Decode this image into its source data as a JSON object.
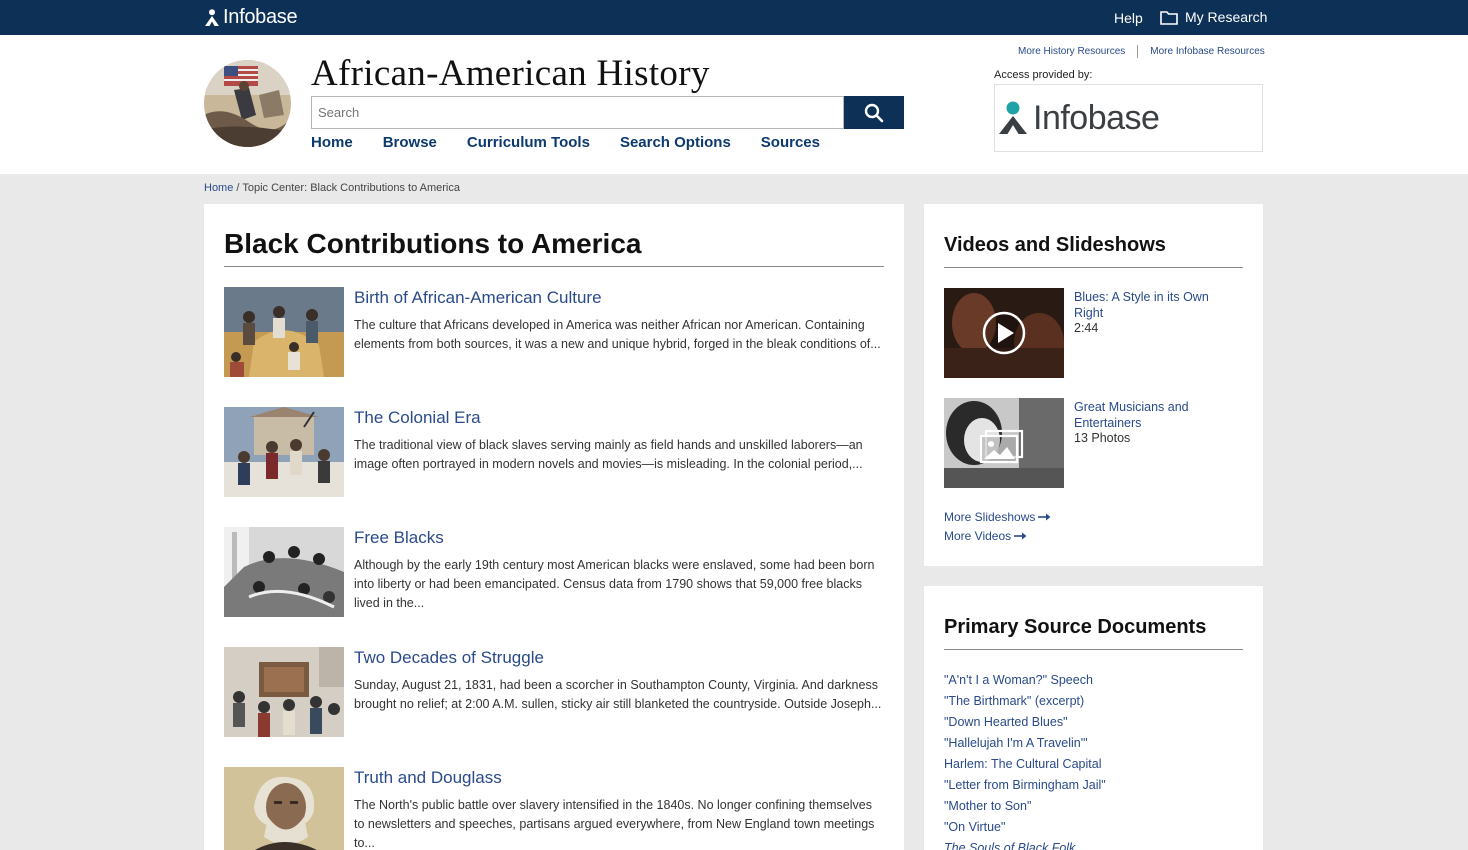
{
  "topbar": {
    "logo_text": "Infobase",
    "help": "Help",
    "my_research": "My Research"
  },
  "header": {
    "site_title": "African-American History",
    "search_placeholder": "Search",
    "nav": [
      "Home",
      "Browse",
      "Curriculum Tools",
      "Search Options",
      "Sources"
    ],
    "more_history": "More History Resources",
    "more_infobase": "More Infobase Resources",
    "access_label": "Access provided by:",
    "access_logo_text": "Infobase"
  },
  "breadcrumb": {
    "home": "Home",
    "separator": " / ",
    "current": "Topic Center: Black Contributions to America"
  },
  "main": {
    "title": "Black Contributions to America",
    "articles": [
      {
        "title": "Birth of African-American Culture",
        "summary": "The culture that Africans developed in America was neither African nor American. Containing elements from both sources, it was a new and unique hybrid, forged in the bleak conditions of..."
      },
      {
        "title": "The Colonial Era",
        "summary": "The traditional view of black slaves serving mainly as field hands and unskilled laborers—an image often portrayed in modern novels and movies—is misleading. In the colonial period,..."
      },
      {
        "title": "Free Blacks",
        "summary": "Although by the early 19th century most American blacks were enslaved, some had been born into liberty or had been emancipated. Census data from 1790 shows that 59,000 free blacks lived in the..."
      },
      {
        "title": "Two Decades of Struggle",
        "summary": "Sunday, August 21, 1831, had been a scorcher in Southampton County, Virginia. And darkness brought no relief; at 2:00 A.M. sullen, sticky air still blanketed the countryside. Outside Joseph..."
      },
      {
        "title": "Truth and Douglass",
        "summary": "The North's public battle over slavery intensified in the 1840s. No longer confining themselves to newsletters and speeches, partisans argued everywhere, from New England town meetings to..."
      }
    ]
  },
  "videos": {
    "title": "Videos and Slideshows",
    "items": [
      {
        "title": "Blues: A Style in its Own Right",
        "meta": "2:44",
        "icon": "play-icon"
      },
      {
        "title": "Great Musicians and Entertainers",
        "meta": "13 Photos",
        "icon": "slideshow-icon"
      }
    ],
    "more_slideshows": "More Slideshows",
    "more_videos": "More Videos"
  },
  "documents": {
    "title": "Primary Source Documents",
    "items": [
      "\"A'n't I a Woman?\" Speech",
      "\"The Birthmark\" (excerpt)",
      "\"Down Hearted Blues\"",
      "\"Hallelujah I'm A Travelin'\"",
      "Harlem: The Cultural Capital",
      "\"Letter from Birmingham Jail\"",
      "\"Mother to Son\"",
      "\"On Virtue\"",
      "The Souls of Black Folk"
    ]
  },
  "colors": {
    "brand_navy": "#0d3057",
    "link_blue": "#2a4a8a",
    "page_bg": "#e9e9e9"
  }
}
